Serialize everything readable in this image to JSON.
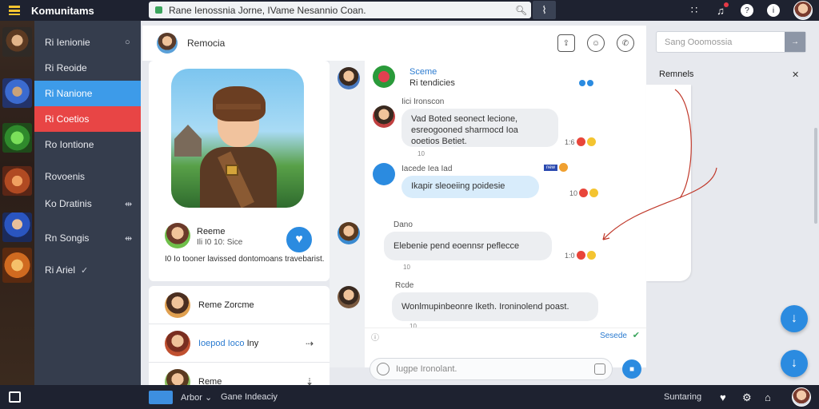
{
  "topbar": {
    "app_title": "Komunitams",
    "search_value": "Rane Ienossnia Jorne, IVame Nesannio Coan.",
    "pulse_icon": "activity-icon",
    "icons": [
      "grid-icon",
      "bell-icon",
      "help-icon",
      "info-icon",
      "avatar"
    ]
  },
  "leftnav": {
    "items": [
      {
        "label": "Ri Ienionie",
        "trail": "○"
      },
      {
        "label": "Ri Reoide",
        "trail": ""
      },
      {
        "label": "Ri Nanione",
        "trail": ""
      },
      {
        "label": "Ri Coetios",
        "trail": ""
      },
      {
        "label": "Ro Iontione",
        "trail": ""
      },
      {
        "label": "Rovoenis",
        "trail": ""
      },
      {
        "label": "Ko Dratinis",
        "trail": "⇹"
      },
      {
        "label": "Rn Songis",
        "trail": "⇹"
      },
      {
        "label": "Ri Ariel",
        "trail": "✓"
      }
    ]
  },
  "chat_header": {
    "title": "Remocia"
  },
  "profile": {
    "name": "Reeme",
    "meta": "Ili I0 10: Sice",
    "description": "I0 Io tooner lavissed dontomoans travebarist."
  },
  "friends": [
    {
      "name": "Reme Zorcme",
      "highlight": "",
      "action": ""
    },
    {
      "name": "Iny",
      "highlight": "Ioepod Ioco",
      "action": "⇢"
    },
    {
      "name": "Reme",
      "highlight": "",
      "action": "⇣"
    }
  ],
  "messages": [
    {
      "name": "Sceme",
      "sub": "Ri tendicies",
      "text": "",
      "time": ""
    },
    {
      "name": "Iici Ironscon",
      "text": "Vad Boted seonect lecione, esreogooned sharmocd Ioa ooetios Betiet.",
      "time": "10",
      "reaction": "1:6"
    },
    {
      "name": "Iacede Iea Iad",
      "text": "Ikapir sleoeiing poidesie",
      "time": "",
      "reaction": "10"
    },
    {
      "name": "Dano",
      "text": "Elebenie pend eoennsr peflecce",
      "time": "10",
      "reaction": "1:0"
    },
    {
      "name": "Rcde",
      "text": "Wonlmupinbeonre Iketh. Ironinolend poast.",
      "time": "10",
      "reaction": ""
    }
  ],
  "typing": {
    "status": "Sesede"
  },
  "compose": {
    "placeholder": "Iugpe Ironolant."
  },
  "right_panel": {
    "search_placeholder": "Sang Ooomossia",
    "title": "Remnels",
    "close": "✕"
  },
  "bottombar": {
    "dropdown": "Arbor",
    "game": "Gane Indeaciy",
    "status": "Suntaring"
  },
  "colors": {
    "accent": "#2b8be0",
    "nav_active": "#3d9be9",
    "nav_alert": "#e84545",
    "dark": "#1e2230",
    "sidebar": "#353d4d"
  }
}
